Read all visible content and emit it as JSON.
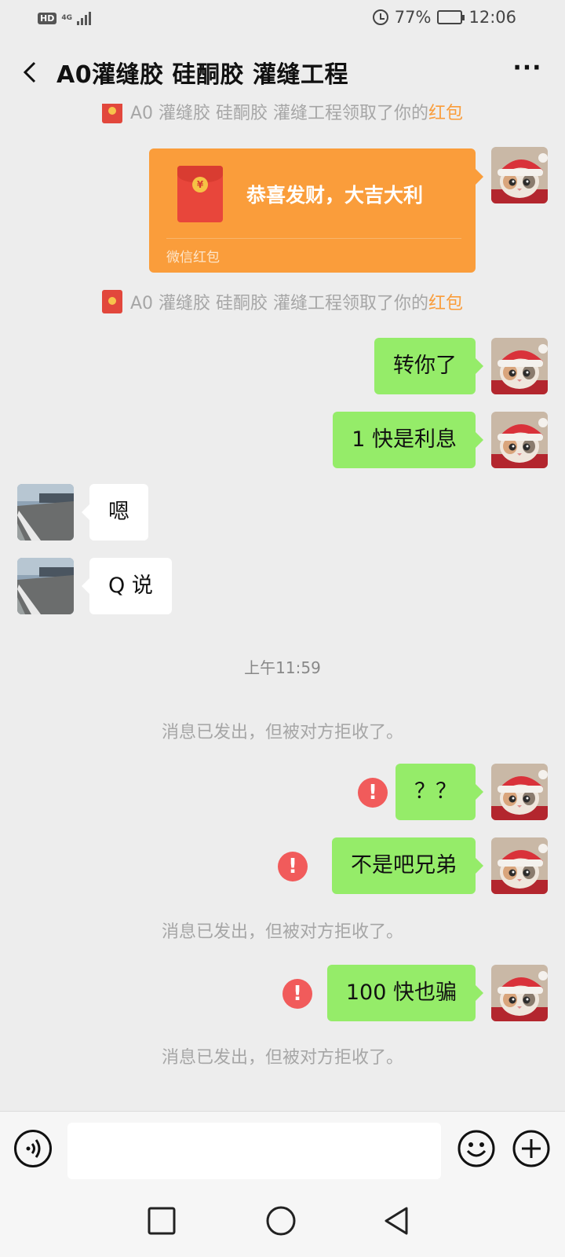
{
  "status_bar": {
    "hd": "HD",
    "network": "4G",
    "battery": "77%",
    "time": "12:06",
    "battery_level": 0.77
  },
  "header": {
    "title": "A0灌缝胶 硅酮胶 灌缝工程",
    "back_icon": "chevron-left-icon",
    "more_icon": "more-dots-icon"
  },
  "messages": {
    "sys_claim_1": {
      "text": "A0 灌缝胶 硅酮胶 灌缝工程领取了你的",
      "highlight": "红包"
    },
    "red_packet": {
      "greeting": "恭喜发财，大吉大利",
      "label": "微信红包",
      "coin": "¥"
    },
    "sys_claim_2": {
      "text": "A0 灌缝胶 硅酮胶 灌缝工程领取了你的",
      "highlight": "红包"
    },
    "msg_1": "转你了",
    "msg_2": "1 快是利息",
    "reply_1": "嗯",
    "reply_2": "Q 说",
    "timestamp": "上午11:59",
    "rejected_1": "消息已发出，但被对方拒收了。",
    "msg_3": "？？",
    "msg_4": "不是吧兄弟",
    "rejected_2": "消息已发出，但被对方拒收了。",
    "msg_5": "100 快也骗",
    "rejected_3": "消息已发出，但被对方拒收了。",
    "error_mark": "!"
  },
  "input_bar": {
    "voice_icon": "voice-icon",
    "input_value": "",
    "emoji_icon": "emoji-icon",
    "plus_icon": "plus-circle-icon"
  },
  "nav_bar": {
    "recent_icon": "square-icon",
    "home_icon": "circle-icon",
    "back_icon": "triangle-back-icon"
  },
  "colors": {
    "background": "#ededed",
    "bubble_green": "#95ec69",
    "red_packet": "#fa9d3b",
    "error_red": "#f15b5b",
    "highlight_orange": "#fa9d3b"
  }
}
